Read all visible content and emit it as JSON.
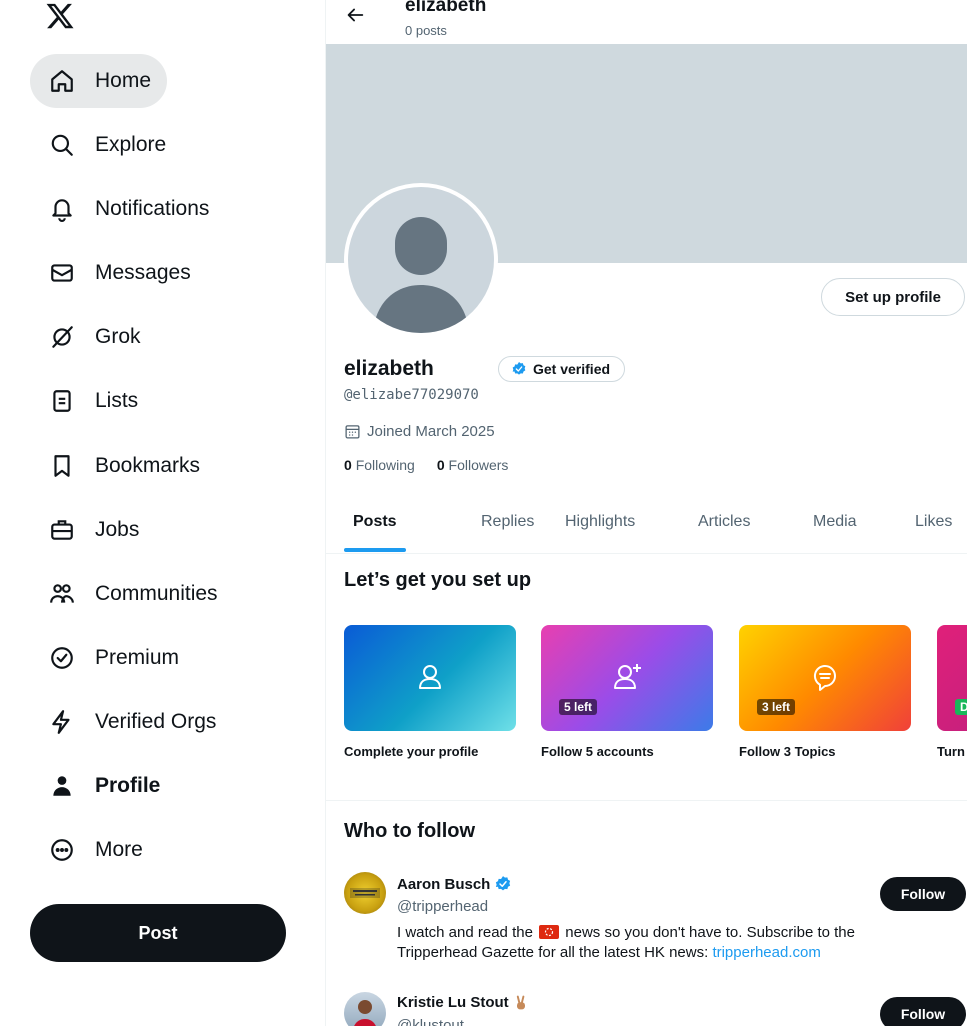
{
  "sidebar": {
    "logo": "x-logo",
    "items": [
      {
        "label": "Home",
        "icon": "home-icon"
      },
      {
        "label": "Explore",
        "icon": "search-icon"
      },
      {
        "label": "Notifications",
        "icon": "bell-icon"
      },
      {
        "label": "Messages",
        "icon": "envelope-icon"
      },
      {
        "label": "Grok",
        "icon": "grok-icon"
      },
      {
        "label": "Lists",
        "icon": "list-icon"
      },
      {
        "label": "Bookmarks",
        "icon": "bookmark-icon"
      },
      {
        "label": "Jobs",
        "icon": "briefcase-icon"
      },
      {
        "label": "Communities",
        "icon": "people-icon"
      },
      {
        "label": "Premium",
        "icon": "premium-icon"
      },
      {
        "label": "Verified Orgs",
        "icon": "lightning-icon"
      },
      {
        "label": "Profile",
        "icon": "person-icon"
      },
      {
        "label": "More",
        "icon": "more-icon"
      }
    ],
    "post_label": "Post"
  },
  "header": {
    "name": "elizabeth",
    "post_count": "0 posts"
  },
  "profile": {
    "setup_label": "Set up profile",
    "name": "elizabeth",
    "verify_label": "Get verified",
    "handle": "@elizabe77029070",
    "joined": "Joined March 2025",
    "following_count": "0",
    "following_label": "Following",
    "followers_count": "0",
    "followers_label": "Followers"
  },
  "tabs": [
    "Posts",
    "Replies",
    "Highlights",
    "Articles",
    "Media",
    "Likes"
  ],
  "setup": {
    "title": "Let’s get you set up",
    "cards": [
      {
        "caption": "Complete your profile",
        "badge": ""
      },
      {
        "caption": "Follow 5 accounts",
        "badge": "5 left"
      },
      {
        "caption": "Follow 3 Topics",
        "badge": "3 left"
      },
      {
        "caption": "Turn",
        "badge": "D"
      }
    ]
  },
  "who_to_follow": {
    "title": "Who to follow",
    "follow_label": "Follow",
    "accounts": [
      {
        "name": "Aaron Busch",
        "handle": "@tripperhead",
        "bio_text": "I watch and read the",
        "bio_text2": "news so you don't have to. Subscribe to the Tripperhead Gazette for all the latest HK news:",
        "bio_link": "tripperhead.com",
        "verified": true
      },
      {
        "name": "Kristie Lu Stout",
        "handle": "@klustout",
        "verified": false
      }
    ]
  },
  "colors": {
    "accent": "#1d9bf0",
    "text": "#0f1419",
    "muted": "#536471",
    "banner": "#cfd9de"
  }
}
